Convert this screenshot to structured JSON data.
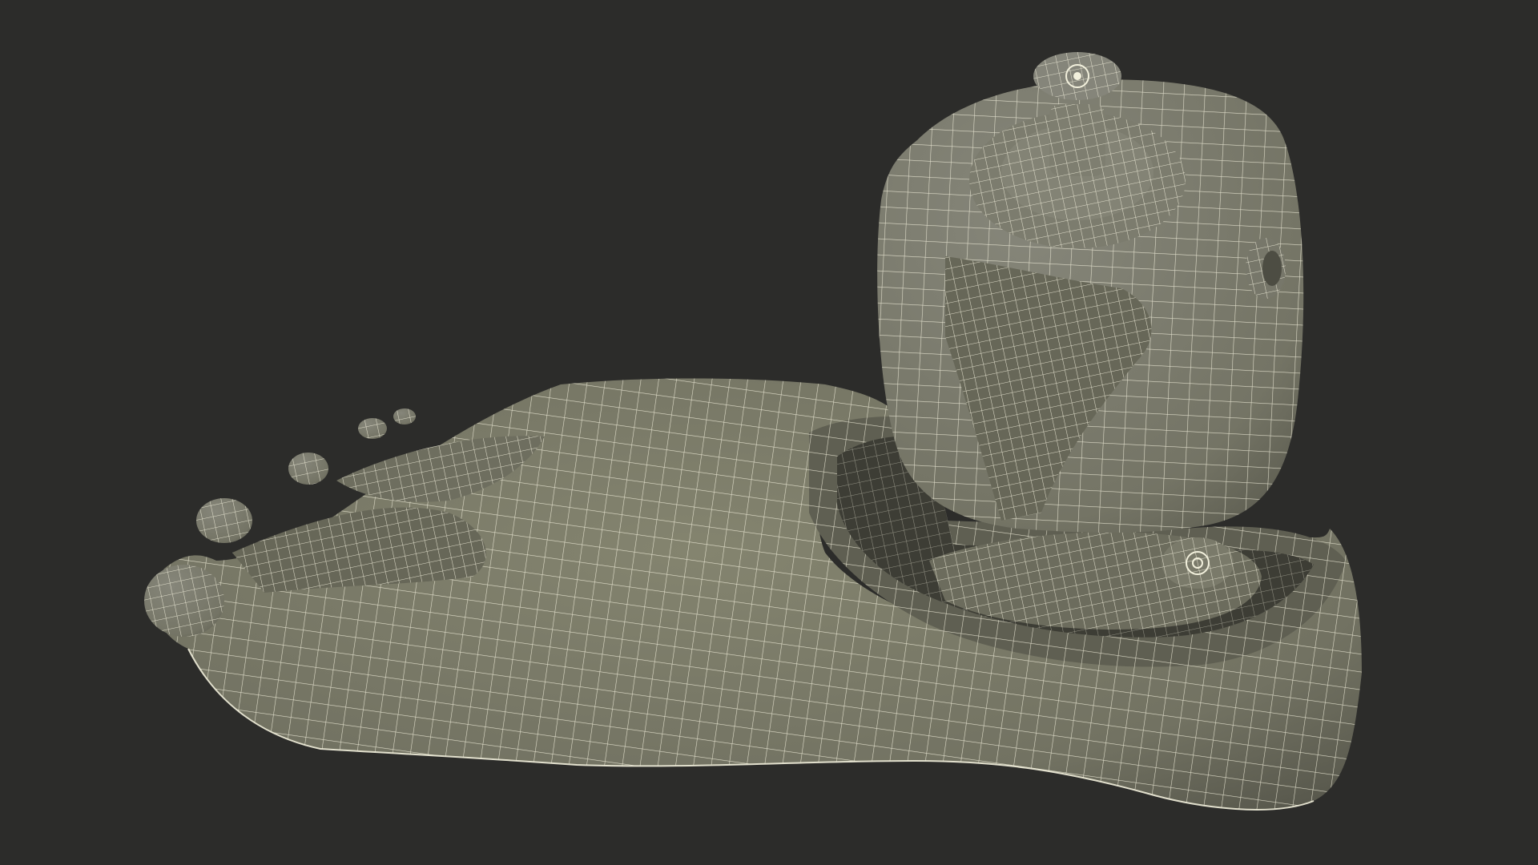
{
  "scene": {
    "subject": "prosthetic-foot-wireframe",
    "render_mode": "wireframe-over-shaded",
    "colors": {
      "background": "#2c2c2a",
      "surface": "#7b7b6b",
      "surface_dark": "#5f5f52",
      "surface_shadow": "#4b4b41",
      "wire": "#f2f0dc",
      "cavity": "#3d3d35"
    }
  }
}
